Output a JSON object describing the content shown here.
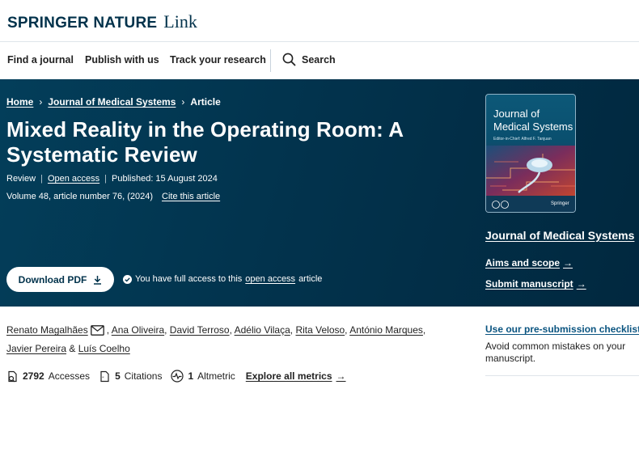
{
  "brand": {
    "name": "SPRINGER NATURE",
    "product": "Link"
  },
  "nav": {
    "items": [
      "Find a journal",
      "Publish with us",
      "Track your research"
    ],
    "search_label": "Search"
  },
  "breadcrumb": {
    "home": "Home",
    "journal": "Journal of Medical Systems",
    "current": "Article"
  },
  "article": {
    "title": "Mixed Reality in the Operating Room: A Systematic Review",
    "type": "Review",
    "access": "Open access",
    "published": "Published: 15 August 2024",
    "volume": "Volume 48, article number 76, (2024)",
    "cite": "Cite this article"
  },
  "download": {
    "label": "Download PDF"
  },
  "access_note": {
    "prefix": "You have full access to this",
    "link": "open access",
    "suffix": "article"
  },
  "cover": {
    "title_line1": "Journal of",
    "title_line2": "Medical Systems",
    "subtitle": "Editor-in-Chief: Alfred F. Tanjuan",
    "publisher": "Springer"
  },
  "sidebar": {
    "journal_title": "Journal of Medical Systems",
    "aims": "Aims and scope",
    "submit": "Submit manuscript"
  },
  "authors": [
    "Renato Magalhães",
    "Ana Oliveira",
    "David Terroso",
    "Adélio Vilaça",
    "Rita Veloso",
    "António Marques",
    "Javier Pereira",
    "Luís Coelho"
  ],
  "metrics": {
    "accesses_count": "2792",
    "accesses_label": "Accesses",
    "citations_count": "5",
    "citations_label": "Citations",
    "altmetric_count": "1",
    "altmetric_label": "Altmetric",
    "explore": "Explore all metrics"
  },
  "checklist": {
    "link": "Use our pre-submission checklist",
    "text": "Avoid common mistakes on your manuscript."
  },
  "colors": {
    "brand_navy": "#01324b",
    "hero_bg": "#02334d",
    "link_blue": "#0a5480"
  }
}
